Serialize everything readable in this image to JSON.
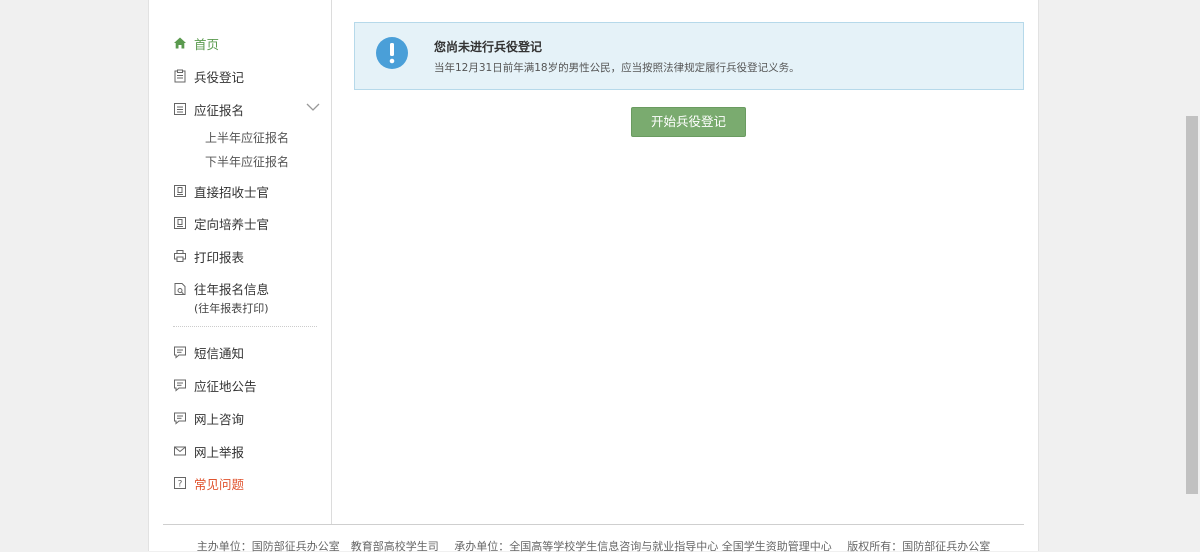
{
  "sidebar": {
    "items": [
      {
        "label": "首页",
        "icon": "home-icon"
      },
      {
        "label": "兵役登记",
        "icon": "clipboard-icon"
      },
      {
        "label": "应征报名",
        "icon": "list-icon"
      },
      {
        "label": "直接招收士官",
        "icon": "badge-icon"
      },
      {
        "label": "定向培养士官",
        "icon": "badge-icon"
      },
      {
        "label": "打印报表",
        "icon": "printer-icon"
      },
      {
        "label": "往年报名信息",
        "note": "(往年报表打印)",
        "icon": "file-search-icon"
      },
      {
        "label": "短信通知",
        "icon": "message-icon"
      },
      {
        "label": "应征地公告",
        "icon": "message-icon"
      },
      {
        "label": "网上咨询",
        "icon": "message-icon"
      },
      {
        "label": "网上举报",
        "icon": "mail-icon"
      },
      {
        "label": "常见问题",
        "icon": "question-icon"
      }
    ],
    "sub_items": [
      {
        "label": "上半年应征报名"
      },
      {
        "label": "下半年应征报名"
      }
    ]
  },
  "notice": {
    "title": "您尚未进行兵役登记",
    "text": "当年12月31日前年满18岁的男性公民，应当按照法律规定履行兵役登记义务。"
  },
  "start_button": {
    "label": "开始兵役登记"
  },
  "footer": {
    "organizer": "主办单位：国防部征兵办公室　教育部高校学生司",
    "operator": "承办单位：全国高等学校学生信息咨询与就业指导中心  全国学生资助管理中心",
    "copyright": "版权所有：国防部征兵办公室"
  },
  "colors": {
    "active": "#5a9a4e",
    "faq": "#e0542f",
    "button": "#7aab6f",
    "notice_bg": "#e5f2f8",
    "notice_icon": "#4a9fd8"
  }
}
